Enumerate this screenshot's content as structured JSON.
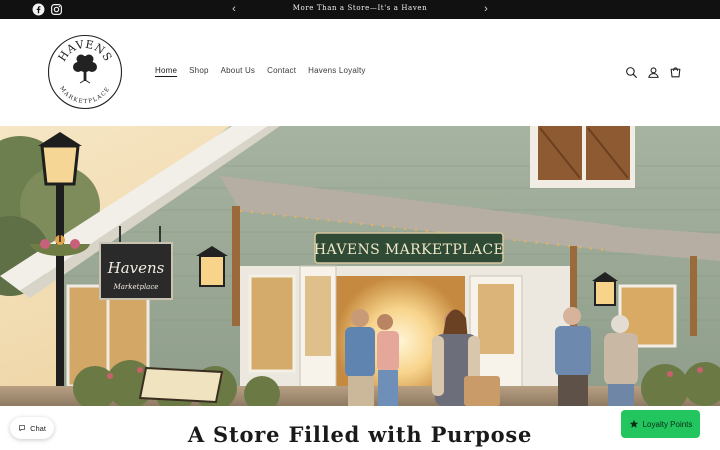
{
  "announcement": {
    "message": "More Than a Store—It's a Haven",
    "prev_arrow": "‹",
    "next_arrow": "›",
    "social_icons": [
      "facebook-icon",
      "instagram-icon"
    ]
  },
  "header": {
    "logo": {
      "top_text": "HAVENS",
      "bottom_text": "MARKETPLACE"
    },
    "nav": [
      {
        "label": "Home",
        "active": true
      },
      {
        "label": "Shop"
      },
      {
        "label": "About Us"
      },
      {
        "label": "Contact"
      },
      {
        "label": "Havens Loyalty"
      }
    ],
    "icons": [
      "search-icon",
      "account-icon",
      "cart-icon"
    ]
  },
  "hero": {
    "store_sign": "HAVENS MARKETPLACE",
    "hanging_sign": {
      "line1": "Havens",
      "line2": "Marketplace"
    }
  },
  "main": {
    "headline": "A Store Filled with Purpose"
  },
  "widgets": {
    "chat_label": "Chat",
    "loyalty_label": "Loyalty Points",
    "loyalty_color": "#22c55e"
  },
  "colors": {
    "announcement_bg": "#111111",
    "siding": "#9fae98",
    "sign_green": "#2f4a35"
  }
}
